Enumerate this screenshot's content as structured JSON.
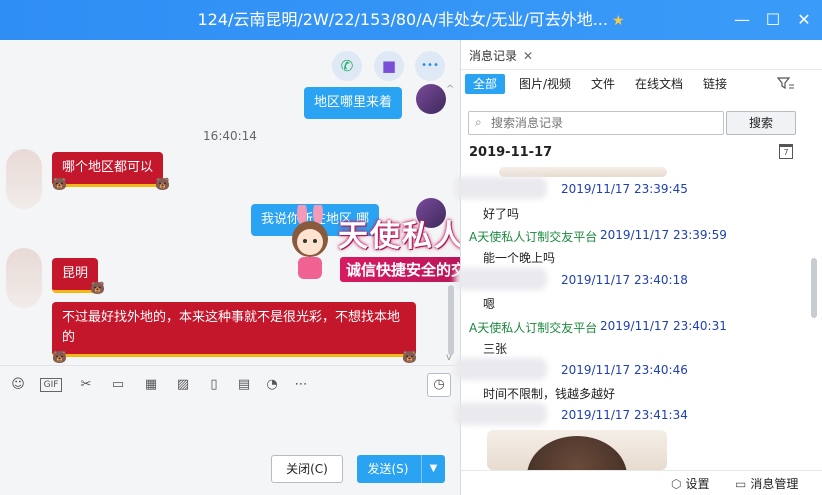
{
  "window": {
    "title": "124/云南昆明/2W/22/153/80/A/非处女/无业/可去外地...",
    "star": "★",
    "minimize": "—",
    "maximize": "☐",
    "close": "✕"
  },
  "chat": {
    "call_icons": {
      "phone": "✆",
      "video": "■",
      "more": "•••"
    },
    "messages": [
      {
        "dir": "out",
        "text": "地区哪里来着"
      },
      {
        "dir": "in",
        "text": "哪个地区都可以"
      },
      {
        "dir": "out",
        "text": "我说你所在地区 哪"
      },
      {
        "dir": "in",
        "text": "昆明"
      },
      {
        "dir": "in",
        "text": "不过最好找外地的，本来这种事就不是很光彩，不想找本地的"
      }
    ],
    "timestamp": "16:40:14",
    "watermark": {
      "line1": "天使私人订制",
      "line2": "诚信快捷安全的交友平台"
    }
  },
  "toolbar": {
    "emoji": "☺",
    "gif": "GIF",
    "scissors": "✂",
    "folder": "▭",
    "grid": "▦",
    "image": "▨",
    "phone": "▯",
    "archive": "▤",
    "record": "◔",
    "more": "⋯",
    "history": "◷"
  },
  "input": {
    "close_label": "关闭(C)",
    "send_label": "发送(S)",
    "send_dropdown": "▼"
  },
  "history": {
    "tab_label": "消息记录",
    "tab_close": "✕",
    "filters": [
      "全部",
      "图片/视频",
      "文件",
      "在线文档",
      "链接"
    ],
    "search_placeholder": "搜索消息记录",
    "search_button": "搜索",
    "date": "2019-11-17",
    "calendar_glyph": "7",
    "items": [
      {
        "time": "2019/11/17 23:39:45",
        "sender": "",
        "text": "好了吗"
      },
      {
        "time": "2019/11/17 23:39:59",
        "sender": "A天使私人订制交友平台",
        "text": "能一个晚上吗"
      },
      {
        "time": "2019/11/17 23:40:18",
        "sender": "",
        "text": "嗯"
      },
      {
        "time": "2019/11/17 23:40:31",
        "sender": "A天使私人订制交友平台",
        "text": "三张"
      },
      {
        "time": "2019/11/17 23:40:46",
        "sender": "",
        "text": "时间不限制，钱越多越好"
      },
      {
        "time": "2019/11/17 23:41:34",
        "sender": "",
        "text": ""
      }
    ],
    "footer": {
      "settings": "设置",
      "settings_icon": "⬡",
      "manage": "消息管理",
      "manage_icon": "▭"
    }
  }
}
